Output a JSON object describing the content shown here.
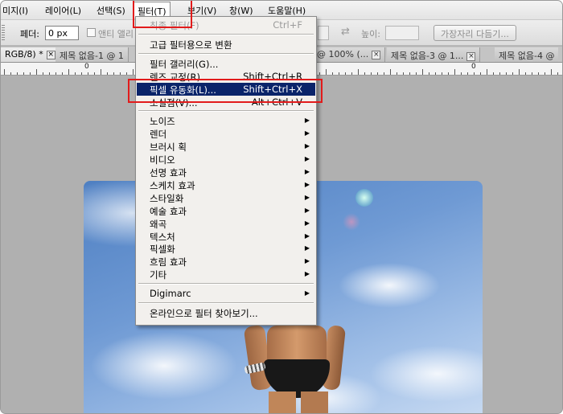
{
  "menubar": {
    "items": [
      {
        "label": "미지(I)"
      },
      {
        "label": "레이어(L)"
      },
      {
        "label": "선택(S)"
      },
      {
        "label": "필터(T)"
      },
      {
        "label": "보기(V)"
      },
      {
        "label": "창(W)"
      },
      {
        "label": "도움말(H)"
      }
    ]
  },
  "options": {
    "feather_label": "페더:",
    "feather_value": "0 px",
    "antialias_label": "앤티 앨리",
    "height_label": "높이:",
    "swap_glyph": "⇄",
    "refine_button": "가장자리 다듬기..."
  },
  "tabs": [
    {
      "label": "RGB/8) *"
    },
    {
      "label": "제목 없음-1 @ 1"
    },
    {
      "label": "@ 100% (..."
    },
    {
      "label": "제목 없음-3 @ 1..."
    },
    {
      "label": "제목 없음-4 @"
    }
  ],
  "ruler": {
    "zero_labels": [
      "0",
      "0"
    ]
  },
  "filter_menu": {
    "items": [
      {
        "label": "최종 필터(F)",
        "shortcut": "Ctrl+F",
        "disabled": true
      },
      {
        "separator": true
      },
      {
        "label": "고급 필터용으로 변환"
      },
      {
        "separator": true
      },
      {
        "label": "필터 갤러리(G)..."
      },
      {
        "label": "렌즈 교정(R)...",
        "shortcut": "Shift+Ctrl+R"
      },
      {
        "label": "픽셀 유동화(L)...",
        "shortcut": "Shift+Ctrl+X",
        "selected": true
      },
      {
        "label": "소실점(V)...",
        "shortcut": "Alt+Ctrl+V"
      },
      {
        "separator": true
      },
      {
        "label": "노이즈",
        "submenu": true
      },
      {
        "label": "렌더",
        "submenu": true
      },
      {
        "label": "브러시 획",
        "submenu": true
      },
      {
        "label": "비디오",
        "submenu": true
      },
      {
        "label": "선명 효과",
        "submenu": true
      },
      {
        "label": "스케치 효과",
        "submenu": true
      },
      {
        "label": "스타일화",
        "submenu": true
      },
      {
        "label": "예술 효과",
        "submenu": true
      },
      {
        "label": "왜곡",
        "submenu": true
      },
      {
        "label": "텍스처",
        "submenu": true
      },
      {
        "label": "픽셀화",
        "submenu": true
      },
      {
        "label": "흐림 효과",
        "submenu": true
      },
      {
        "label": "기타",
        "submenu": true
      },
      {
        "separator": true
      },
      {
        "label": "Digimarc",
        "submenu": true
      },
      {
        "separator": true
      },
      {
        "label": "온라인으로 필터 찾아보기..."
      }
    ]
  },
  "colors": {
    "selection": "#0a246a",
    "highlight": "#e21b1b",
    "menu_bg": "#f2f0ed"
  }
}
